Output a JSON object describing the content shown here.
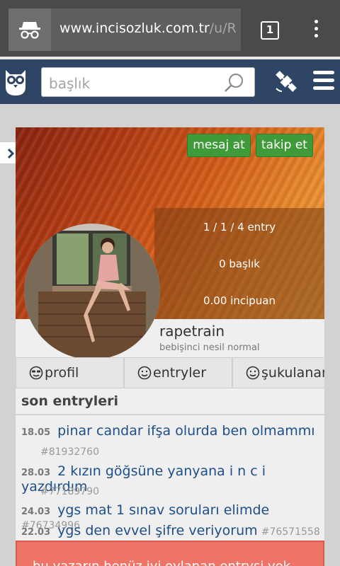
{
  "browser": {
    "url_host": "www.incisozluk.com.tr",
    "url_path": "/u/R",
    "tab_count": "1"
  },
  "header": {
    "search_placeholder": "başlık"
  },
  "profile": {
    "buttons": {
      "message": "mesaj at",
      "follow": "takip et"
    },
    "stats": {
      "entries": "1 / 1 / 4 entry",
      "topics": "0 başlık",
      "points": "0.00 incipuan"
    },
    "username": "rapetrain",
    "subtitle": "bebişinci nesil normal",
    "tabs": [
      "profil",
      "entryler",
      "şukulananlar"
    ]
  },
  "recent": {
    "title": "son entryleri",
    "items": [
      {
        "date": "18.05",
        "title": "pinar candar ifşa olurda ben olmammı",
        "id": "#81932760"
      },
      {
        "date": "28.03",
        "title": "2 kızın göğsüne yanyana i n c i yazdırdım",
        "id": "#77189790"
      },
      {
        "date": "24.03",
        "title": "ygs mat 1 sınav soruları elimde",
        "id": "#76734996"
      },
      {
        "date": "22.03",
        "title": "ygs den evvel şifre veriyorum",
        "id": "#76571558"
      }
    ]
  },
  "alert": {
    "text": "bu yazarın henüz iyi oylanan entrysi yok"
  }
}
